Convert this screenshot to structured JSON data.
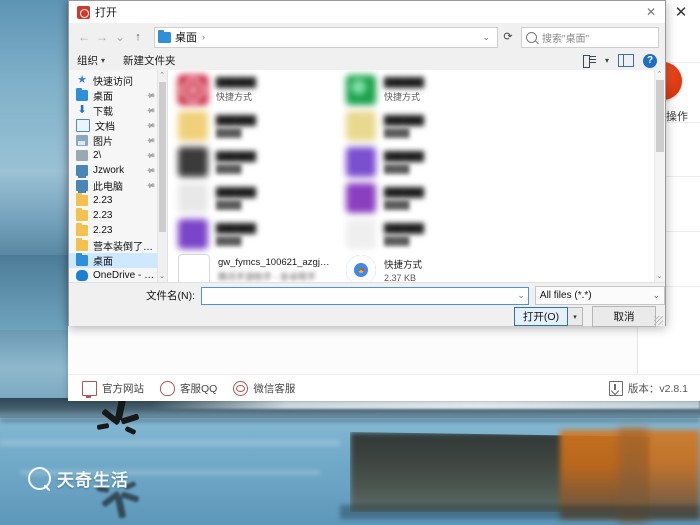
{
  "wallpaper": {
    "watermark": "天奇生活",
    "watermark_logo_icon": "circle-q-logo-icon"
  },
  "app_window": {
    "close_label": "✕",
    "action_text": "操作",
    "footer": {
      "items": [
        {
          "label": "官方网站",
          "icon": "monitor-icon"
        },
        {
          "label": "客服QQ",
          "icon": "penguin-icon"
        },
        {
          "label": "微信客服",
          "icon": "wechat-icon"
        }
      ],
      "version": "版本：v2.8.1",
      "version_icon": "download-icon"
    }
  },
  "dialog": {
    "title": "打开",
    "title_icon": "app-red-icon",
    "close_label": "✕",
    "nav": {
      "back_icon": "arrow-left-icon",
      "forward_icon": "arrow-right-icon",
      "recent_icon": "chevron-down-icon",
      "up_icon": "arrow-up-icon",
      "address_text": "桌面",
      "address_folder_icon": "folder-icon",
      "address_chevron": "›",
      "address_dropdown_icon": "chevron-down-icon",
      "refresh_icon": "refresh-icon",
      "search_placeholder": "搜索\"桌面\"",
      "search_icon": "search-icon"
    },
    "toolbar": {
      "organize_label": "组织",
      "organize_caret": "▾",
      "new_folder_label": "新建文件夹",
      "view_options_icon": "view-options-icon",
      "view_caret": "▾",
      "preview_pane_icon": "preview-pane-icon",
      "help_icon": "help-icon",
      "help_label": "?"
    },
    "sidebar": {
      "scroll_up_icon": "chevron-up-icon",
      "scroll_down_icon": "chevron-down-icon",
      "items": [
        {
          "label": "快速访问",
          "icon": "star-icon",
          "pinned": false,
          "selected": false
        },
        {
          "label": "桌面",
          "icon": "desktop-icon",
          "pinned": true,
          "selected": false
        },
        {
          "label": "下载",
          "icon": "download-icon",
          "pinned": true,
          "selected": false
        },
        {
          "label": "文档",
          "icon": "documents-icon",
          "pinned": true,
          "selected": false
        },
        {
          "label": "图片",
          "icon": "pictures-icon",
          "pinned": true,
          "selected": false
        },
        {
          "label": "2\\",
          "icon": "drive-icon",
          "pinned": true,
          "selected": false
        },
        {
          "label": "Jzwork",
          "icon": "computer-icon",
          "pinned": true,
          "selected": false
        },
        {
          "label": "此电脑",
          "icon": "computer-icon",
          "pinned": true,
          "selected": false
        },
        {
          "label": "2.23",
          "icon": "folder-icon",
          "pinned": false,
          "selected": false
        },
        {
          "label": "2.23",
          "icon": "folder-icon",
          "pinned": false,
          "selected": false
        },
        {
          "label": "2.23",
          "icon": "folder-icon",
          "pinned": false,
          "selected": false
        },
        {
          "label": "营本装倒了怎么",
          "icon": "folder-icon",
          "pinned": false,
          "selected": false
        },
        {
          "label": "桌面",
          "icon": "desktop-icon",
          "pinned": false,
          "selected": true
        },
        {
          "label": "OneDrive - Per",
          "icon": "cloud-icon",
          "pinned": false,
          "selected": false
        }
      ]
    },
    "files": {
      "scroll_up_icon": "chevron-up-icon",
      "scroll_down_icon": "chevron-down-icon",
      "items": [
        {
          "name": "",
          "sub": "快捷方式",
          "icon_color": "#c8102e",
          "blurred_name": true,
          "blurred_sub": false,
          "col": 0,
          "row": 0
        },
        {
          "name": "",
          "sub": "快捷方式",
          "icon_color": "#1aa14b",
          "blurred_name": true,
          "blurred_sub": false,
          "col": 1,
          "row": 0
        },
        {
          "name": "",
          "sub": "",
          "icon_color": "#f0d07a",
          "blurred_name": true,
          "blurred_sub": true,
          "col": 0,
          "row": 1
        },
        {
          "name": "",
          "sub": "",
          "icon_color": "#e8d98f",
          "blurred_name": true,
          "blurred_sub": true,
          "col": 1,
          "row": 1
        },
        {
          "name": "",
          "sub": "",
          "icon_color": "#3b3b3b",
          "blurred_name": true,
          "blurred_sub": true,
          "col": 0,
          "row": 2
        },
        {
          "name": "",
          "sub": "",
          "icon_color": "#7a4fd0",
          "blurred_name": true,
          "blurred_sub": true,
          "col": 1,
          "row": 2
        },
        {
          "name": "",
          "sub": "",
          "icon_color": "#e8e8e8",
          "blurred_name": true,
          "blurred_sub": true,
          "col": 0,
          "row": 3
        },
        {
          "name": "",
          "sub": "",
          "icon_color": "#8a3fc0",
          "blurred_name": true,
          "blurred_sub": true,
          "col": 1,
          "row": 3
        },
        {
          "name": "",
          "sub": "",
          "icon_color": "#7a45c8",
          "blurred_name": true,
          "blurred_sub": true,
          "col": 0,
          "row": 4
        },
        {
          "name": "",
          "sub": "",
          "icon_color": "#efefef",
          "blurred_name": true,
          "blurred_sub": true,
          "col": 1,
          "row": 4
        },
        {
          "name": "gw_fymcs_100621_azgj_1689_1...",
          "sub": "腾讯手游助手 - 安卓帮手",
          "icon_color": "#ffffff",
          "blurred_name": false,
          "blurred_sub": true,
          "col": 0,
          "row": 5
        },
        {
          "name": "快捷方式",
          "sub": "2.37 KB",
          "icon_color": "#4285f4",
          "blurred_name": false,
          "blurred_sub": false,
          "col": 1,
          "row": 5
        }
      ]
    },
    "bottom": {
      "filename_label": "文件名(N):",
      "filename_value": "",
      "filename_dropdown_icon": "chevron-down-icon",
      "filetype_value": "All files (*.*)",
      "filetype_dropdown_icon": "chevron-down-icon",
      "open_label": "打开(O)",
      "open_arrow": "▾",
      "cancel_label": "取消"
    }
  }
}
